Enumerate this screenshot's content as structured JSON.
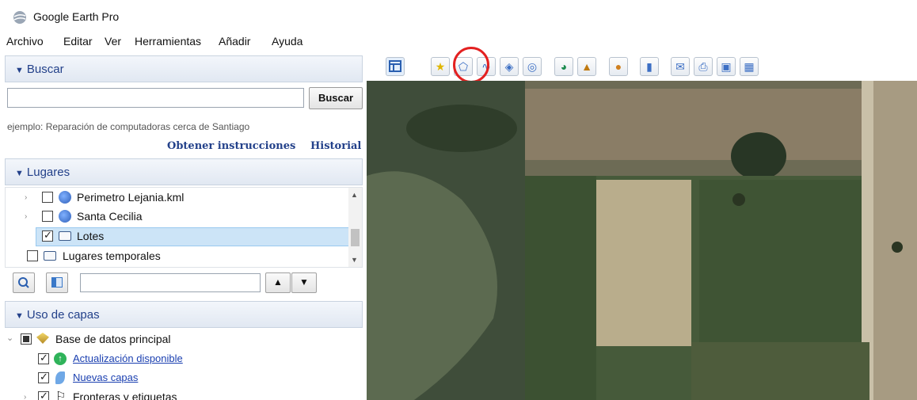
{
  "window": {
    "title": "Google Earth Pro"
  },
  "menu": [
    "Archivo",
    "Editar",
    "Ver",
    "Herramientas",
    "Añadir",
    "Ayuda"
  ],
  "search": {
    "header": "Buscar",
    "value": "",
    "button": "Buscar",
    "hint": "ejemplo: Reparación de computadoras cerca de Santiago",
    "link_directions": "Obtener instrucciones",
    "link_history": "Historial"
  },
  "places": {
    "header": "Lugares",
    "items": [
      {
        "label": "Perimetro Lejania.kml",
        "checked": false,
        "icon": "globe-icon"
      },
      {
        "label": "Santa Cecilia",
        "checked": false,
        "icon": "globe-icon"
      },
      {
        "label": "Lotes",
        "checked": true,
        "icon": "folder-icon"
      },
      {
        "label": "Lugares temporales",
        "checked": false,
        "icon": "folder-icon"
      }
    ],
    "search_value": ""
  },
  "layers": {
    "header": "Uso de capas",
    "items": [
      {
        "label": "Base de datos principal",
        "state": "partial"
      },
      {
        "label": "Actualización disponible",
        "state": "checked",
        "link": true
      },
      {
        "label": "Nuevas capas",
        "state": "checked",
        "link": true
      },
      {
        "label": "Fronteras y etiquetas",
        "state": "checked",
        "link": false
      }
    ]
  },
  "toolbar": {
    "buttons": [
      "sidebar-toggle-icon",
      "placemark-icon",
      "polygon-icon",
      "path-icon",
      "overlay-icon",
      "record-tour-icon",
      "historical-imagery-icon",
      "sunlight-icon",
      "planets-icon",
      "ruler-icon",
      "email-icon",
      "print-icon",
      "save-image-icon",
      "maps-icon"
    ],
    "highlighted": "polygon-icon"
  },
  "colors": {
    "accent": "#23418a",
    "highlight_circle": "#e32020",
    "selection": "#cce4f7"
  }
}
